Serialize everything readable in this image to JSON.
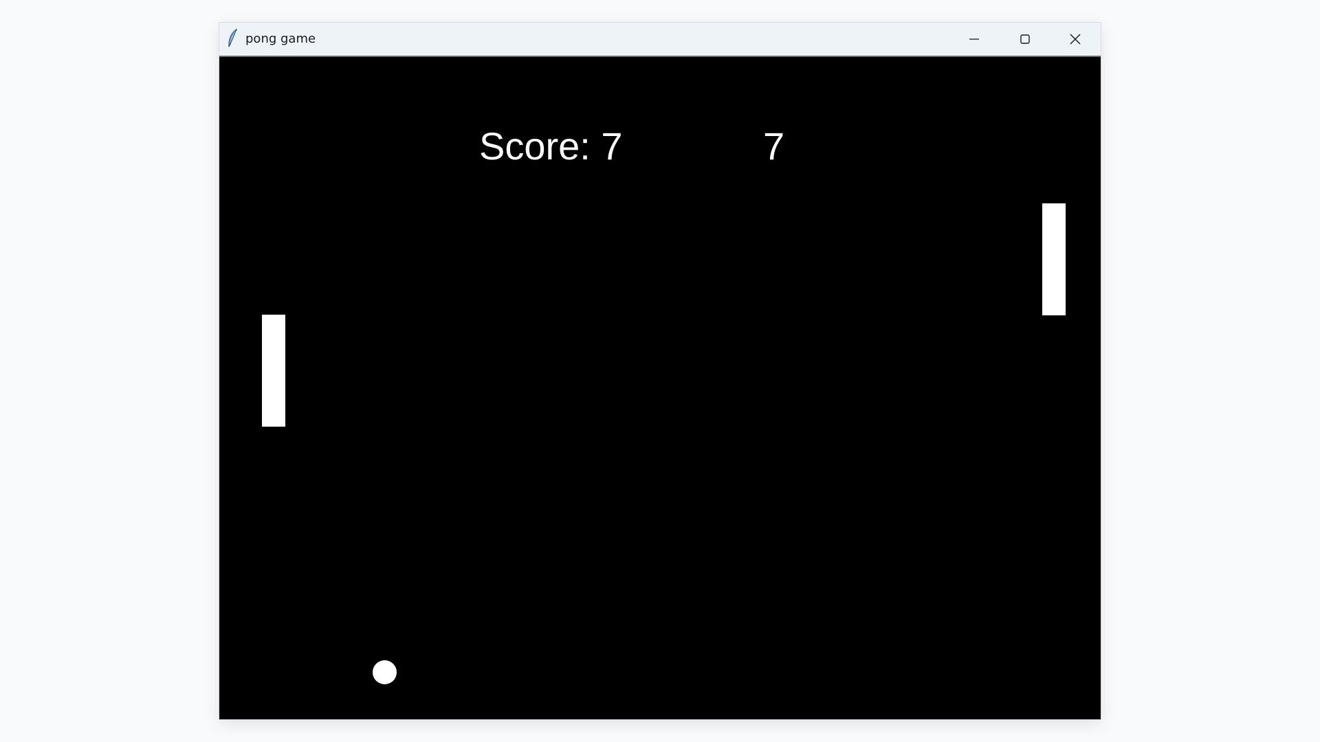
{
  "window": {
    "title": "pong game",
    "app_icon": "feather-icon",
    "controls": {
      "minimize_icon": "minimize-icon",
      "maximize_icon": "maximize-icon",
      "close_icon": "close-icon"
    }
  },
  "game": {
    "score_left": "Score: 7",
    "score_right": "7",
    "background_color": "#000000",
    "foreground_color": "#ffffff"
  }
}
